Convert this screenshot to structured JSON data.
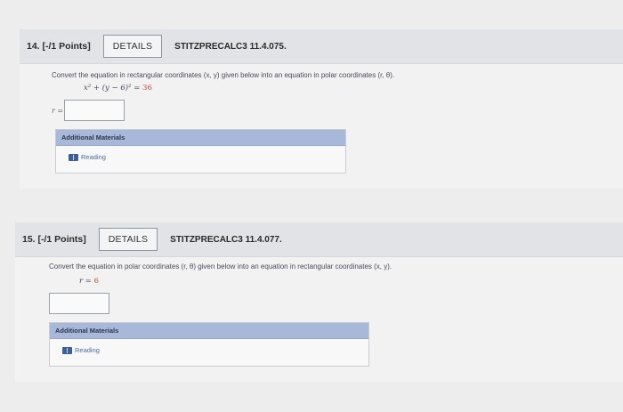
{
  "q14": {
    "number": "14. [-/1 Points]",
    "details_label": "DETAILS",
    "problem_id": "STITZPRECALC3 11.4.075.",
    "prompt": "Convert the equation in rectangular coordinates (x, y) given below into an equation in polar coordinates (r, θ).",
    "equation_lhs": "x² + (y − 6)² =",
    "equation_rhs": "36",
    "answer_label": "r =",
    "answer_value": "",
    "additional_materials": "Additional Materials",
    "reading": "Reading"
  },
  "q15": {
    "number": "15. [-/1 Points]",
    "details_label": "DETAILS",
    "problem_id": "STITZPRECALC3 11.4.077.",
    "prompt": "Convert the equation in polar coordinates (r, θ) given below into an equation in rectangular coordinates (x, y).",
    "equation_lhs": "r =",
    "equation_rhs": "6",
    "answer_value": "",
    "additional_materials": "Additional Materials",
    "reading": "Reading"
  }
}
